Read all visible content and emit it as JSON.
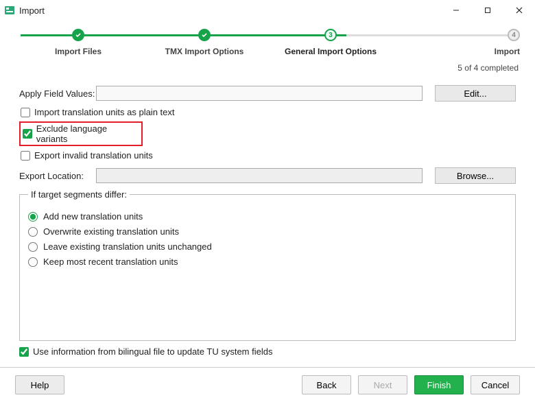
{
  "window": {
    "title": "Import"
  },
  "stepper": {
    "steps": [
      {
        "label": "Import Files",
        "num": "✓"
      },
      {
        "label": "TMX Import Options",
        "num": "✓"
      },
      {
        "label": "General Import Options",
        "num": "3"
      },
      {
        "label": "Import",
        "num": "4"
      }
    ]
  },
  "status": "5 of 4 completed",
  "form": {
    "apply_field_values_label": "Apply Field Values:",
    "apply_field_values_value": "",
    "edit_btn": "Edit...",
    "chk_plain_text": "Import translation units as plain text",
    "chk_exclude_variants": "Exclude language variants",
    "chk_export_invalid": "Export invalid translation units",
    "export_location_label": "Export Location:",
    "export_location_value": "",
    "browse_btn": "Browse...",
    "group_legend": "If target segments differ:",
    "radios": [
      "Add new translation units",
      "Overwrite existing translation units",
      "Leave existing translation units unchanged",
      "Keep most recent translation units"
    ],
    "chk_use_bilingual": "Use information from bilingual file to update TU system fields"
  },
  "footer": {
    "help": "Help",
    "back": "Back",
    "next": "Next",
    "finish": "Finish",
    "cancel": "Cancel"
  }
}
